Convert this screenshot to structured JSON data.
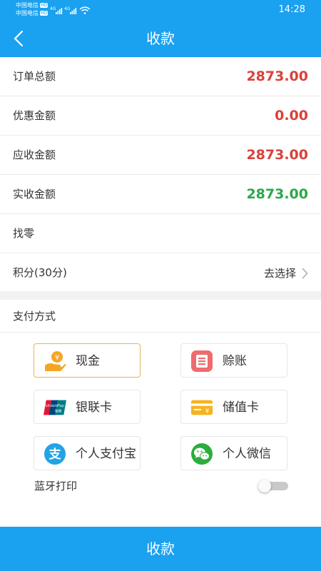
{
  "status_bar": {
    "carrier_1": "中国电信",
    "carrier_2": "中国电信",
    "hd_badge": "HD",
    "network": "4G",
    "time": "14:28"
  },
  "nav": {
    "title": "收款"
  },
  "rows": [
    {
      "label": "订单总额",
      "value": "2873.00",
      "color": "#d9413a"
    },
    {
      "label": "优惠金额",
      "value": "0.00",
      "color": "#d9413a"
    },
    {
      "label": "应收金额",
      "value": "2873.00",
      "color": "#d9413a"
    },
    {
      "label": "实收金额",
      "value": "2873.00",
      "color": "#2aa84a"
    },
    {
      "label": "找零",
      "value": ""
    }
  ],
  "points": {
    "label": "积分(30分)",
    "action": "去选择"
  },
  "payment": {
    "title": "支付方式",
    "methods": [
      {
        "label": "现金",
        "icon": "cash-hand-icon",
        "selected": true
      },
      {
        "label": "赊账",
        "icon": "credit-note-icon",
        "selected": false
      },
      {
        "label": "银联卡",
        "icon": "unionpay-card-icon",
        "selected": false
      },
      {
        "label": "储值卡",
        "icon": "stored-value-card-icon",
        "selected": false
      },
      {
        "label": "个人支付宝",
        "icon": "alipay-icon",
        "selected": false
      },
      {
        "label": "个人微信",
        "icon": "wechat-icon",
        "selected": false
      }
    ],
    "icon_text": {
      "cash_coin": "¥",
      "unionpay_brand": "UnionPay",
      "unionpay_cn": "银联",
      "stored_value_coin": "¥",
      "alipay_glyph": "支"
    }
  },
  "bluetooth_print": {
    "label": "蓝牙打印",
    "enabled": false
  },
  "submit": {
    "label": "收款"
  },
  "colors": {
    "primary": "#1aa1f0",
    "amount_red": "#d9413a",
    "amount_green": "#2aa84a",
    "selected_border": "#e3b75a"
  }
}
